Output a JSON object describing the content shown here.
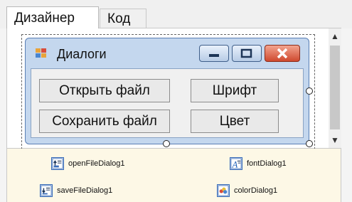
{
  "tabs": {
    "designer": "Дизайнер",
    "code": "Код"
  },
  "form": {
    "title": "Диалоги"
  },
  "buttons": {
    "open_file": "Открыть файл",
    "save_file": "Сохранить файл",
    "font": "Шрифт",
    "color": "Цвет"
  },
  "components": {
    "open_dialog": "openFileDialog1",
    "font_dialog": "fontDialog1",
    "save_dialog": "saveFileDialog1",
    "color_dialog": "colorDialog1"
  },
  "icons": {
    "app": "form-app-icon",
    "minimize": "minimize-icon",
    "maximize": "maximize-icon",
    "close": "close-icon",
    "open_dialog": "open-file-dialog-icon",
    "font_dialog": "font-dialog-icon",
    "save_dialog": "save-file-dialog-icon",
    "color_dialog": "color-dialog-icon"
  },
  "colors": {
    "window_frame": "#c4d7ee",
    "close_button": "#cf4a2f",
    "tray_background": "#fdf8e6"
  }
}
